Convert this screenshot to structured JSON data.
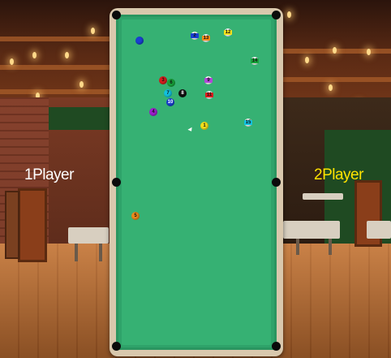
{
  "players": {
    "player1": {
      "label": "1Player",
      "color": "#ffffff"
    },
    "player2": {
      "label": "2Player",
      "color": "#ffe400"
    }
  },
  "table": {
    "felt_color": "#2fa36a",
    "rail_color": "#d9c8ad",
    "pockets": [
      "top-left",
      "top-right",
      "middle-left",
      "middle-right",
      "bottom-left",
      "bottom-right"
    ]
  },
  "balls": [
    {
      "number": "1",
      "color": "#f5e21b",
      "striped": false
    },
    {
      "number": "2",
      "color": "#1a3fd1",
      "striped": true
    },
    {
      "number": "3",
      "color": "#d81e1e",
      "striped": false
    },
    {
      "number": "4",
      "color": "#a020d0",
      "striped": false
    },
    {
      "number": "5",
      "color": "#f08a1a",
      "striped": false
    },
    {
      "number": "6",
      "color": "#18a33a",
      "striped": false
    },
    {
      "number": "7",
      "color": "#12c2e0",
      "striped": false
    },
    {
      "number": "8",
      "color": "#111111",
      "striped": false
    },
    {
      "number": "9",
      "color": "#b046d8",
      "striped": true
    },
    {
      "number": "10",
      "color": "#1a3fd1",
      "striped": false
    },
    {
      "number": "11",
      "color": "#d81e1e",
      "striped": true
    },
    {
      "number": "12",
      "color": "#f5e21b",
      "striped": true
    },
    {
      "number": "13",
      "color": "#f08a1a",
      "striped": true
    },
    {
      "number": "14",
      "color": "#18a33a",
      "striped": true
    },
    {
      "number": "15",
      "color": "#12c2e0",
      "striped": true
    },
    {
      "number": "",
      "color": "#1a3fd1",
      "striped": false,
      "id": "cue"
    }
  ]
}
